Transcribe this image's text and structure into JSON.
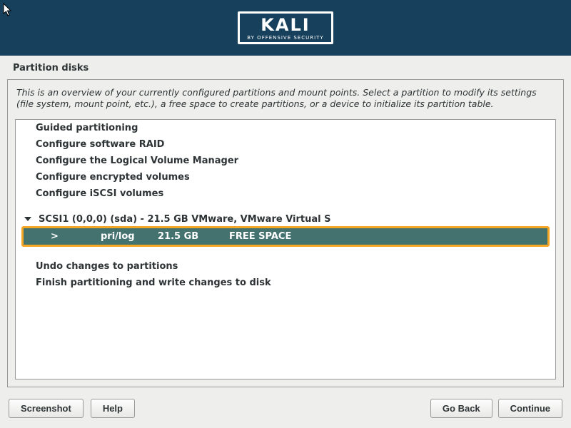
{
  "header": {
    "logo_text": "KALI",
    "logo_sub": "BY OFFENSIVE SECURITY"
  },
  "title": "Partition disks",
  "description": "This is an overview of your currently configured partitions and mount points. Select a partition to modify its settings (file system, mount point, etc.), a free space to create partitions, or a device to initialize its partition table.",
  "menu_items": {
    "guided": "Guided partitioning",
    "raid": "Configure software RAID",
    "lvm": "Configure the Logical Volume Manager",
    "encrypted": "Configure encrypted volumes",
    "iscsi": "Configure iSCSI volumes"
  },
  "disk": {
    "name": "SCSI1 (0,0,0) (sda) - 21.5 GB VMware, VMware Virtual S",
    "partition": {
      "marker": ">",
      "type": "pri/log",
      "size": "21.5 GB",
      "label": "FREE SPACE"
    }
  },
  "actions": {
    "undo": "Undo changes to partitions",
    "finish": "Finish partitioning and write changes to disk"
  },
  "buttons": {
    "screenshot": "Screenshot",
    "help": "Help",
    "go_back": "Go Back",
    "continue": "Continue"
  }
}
